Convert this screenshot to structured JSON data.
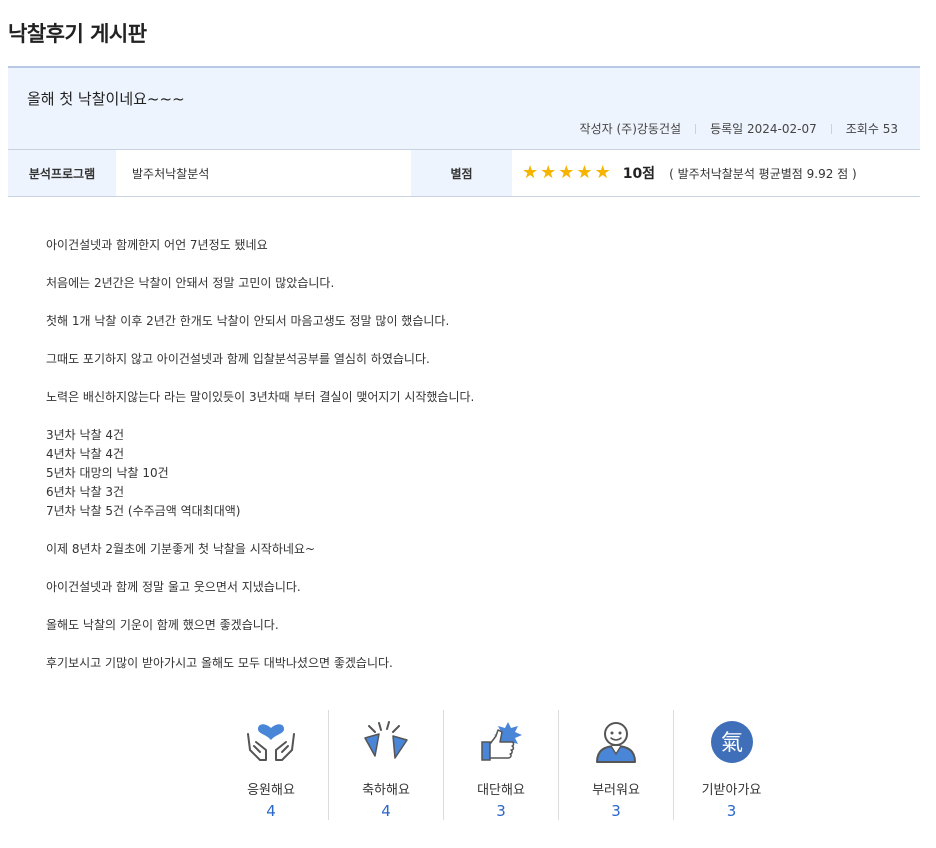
{
  "board": {
    "title": "낙찰후기 게시판"
  },
  "post": {
    "title": "올해 첫 낙찰이네요~~~",
    "author_label": "작성자",
    "author": "(주)강동건설",
    "date_label": "등록일",
    "date": "2024-02-07",
    "views_label": "조회수",
    "views": "53"
  },
  "info": {
    "program_label": "분석프로그램",
    "program_value": "발주처낙찰분석",
    "rating_label": "별점",
    "rating_stars": 5,
    "score_text": "10점",
    "average_text": "( 발주처낙찰분석 평균별점 9.92 점 )"
  },
  "content": {
    "paragraphs": [
      "아이건설넷과 함께한지 어언 7년정도 됐네요",
      "처음에는 2년간은 낙찰이 안돼서 정말 고민이 많았습니다.",
      "첫해 1개 낙찰 이후 2년간 한개도 낙찰이 안되서 마음고생도 정말 많이 했습니다.",
      "그때도 포기하지 않고 아이건설넷과 함께 입찰분석공부를 열심히 하였습니다.",
      "노력은 배신하지않는다 라는 말이있듯이 3년차때 부터 결실이 맺어지기 시작했습니다.",
      "3년차 낙찰 4건\n4년차 낙찰 4건\n5년차 대망의 낙찰 10건\n6년차 낙찰 3건\n7년차 낙찰 5건 (수주금액 역대최대액)",
      "이제 8년차 2월초에 기분좋게 첫 낙찰을 시작하네요~",
      "아이건설넷과 함께 정말 울고 웃으면서 지냈습니다.",
      "올해도 낙찰의 기운이 함께 했으면 좋겠습니다.",
      "후기보시고 기많이 받아가시고 올해도 모두 대박나셨으면 좋겠습니다."
    ]
  },
  "reactions": [
    {
      "label": "응원해요",
      "count": "4",
      "icon": "cheer-hands-heart-icon"
    },
    {
      "label": "축하해요",
      "count": "4",
      "icon": "party-popper-icon"
    },
    {
      "label": "대단해요",
      "count": "3",
      "icon": "thumbs-up-icon"
    },
    {
      "label": "부러워요",
      "count": "3",
      "icon": "envious-person-icon"
    },
    {
      "label": "기받아가요",
      "count": "3",
      "icon": "gi-energy-icon",
      "glyph": "氣"
    }
  ],
  "colors": {
    "accent_blue": "#2a67c8",
    "header_bg": "#eef4fd",
    "star": "#f5b400",
    "icon_blue": "#4a86d8"
  }
}
